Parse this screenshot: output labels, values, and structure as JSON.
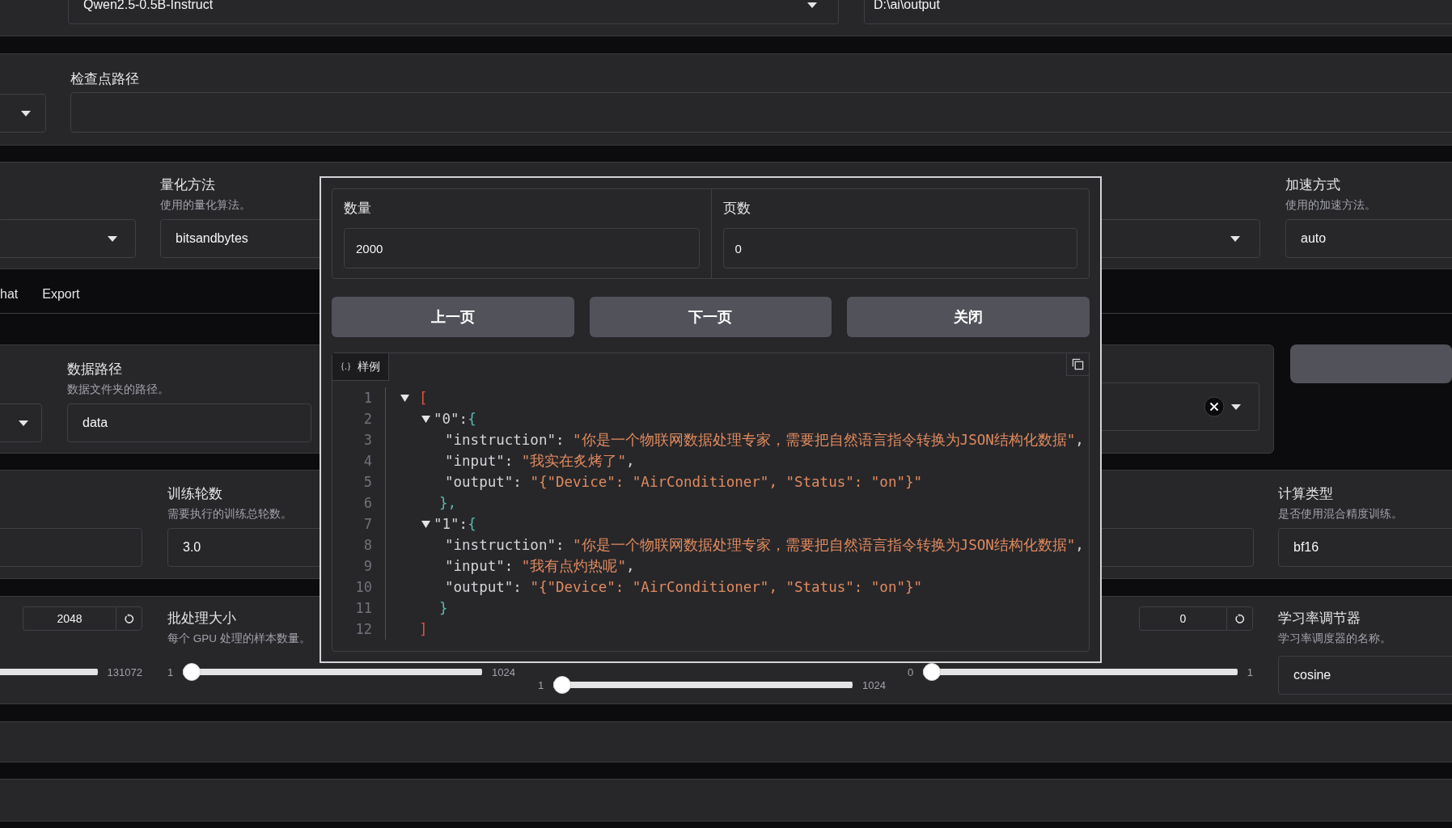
{
  "top_row": {
    "model_name": "Qwen2.5-0.5B-Instruct",
    "output_dir": "D:\\ai\\output"
  },
  "checkpoint": {
    "label": "检查点路径"
  },
  "quantization": {
    "label": "量化方法",
    "description": "使用的量化算法。",
    "value": "bitsandbytes"
  },
  "acceleration": {
    "label": "加速方式",
    "description": "使用的加速方法。",
    "value": "auto"
  },
  "tabs": [
    {
      "label": "hat",
      "selected": false
    },
    {
      "label": "Export",
      "selected": false
    }
  ],
  "dataset_dir": {
    "label": "数据路径",
    "description": "数据文件夹的路径。",
    "value": "data"
  },
  "epochs": {
    "label": "训练轮数",
    "description": "需要执行的训练总轮数。",
    "value": "3.0"
  },
  "compute_type": {
    "label": "计算类型",
    "description": "是否使用混合精度训练。",
    "value": "bf16"
  },
  "cutoff": {
    "value": "2048",
    "max": "131072"
  },
  "batch_size": {
    "label": "批处理大小",
    "description": "每个 GPU 处理的样本数量。",
    "min": "1",
    "max": "1024",
    "level": 0
  },
  "column_3": {
    "min": "1",
    "max": "1024",
    "level": 0
  },
  "column_4": {
    "value": "0",
    "min": "0",
    "max": "1",
    "level": 0
  },
  "lr_scheduler": {
    "label": "学习率调节器",
    "description": "学习率调度器的名称。",
    "value": "cosine"
  },
  "modal": {
    "count": {
      "label": "数量",
      "value": "2000"
    },
    "page": {
      "label": "页数",
      "value": "0"
    },
    "buttons": [
      "上一页",
      "下一页",
      "关闭"
    ],
    "preview": {
      "tab": "样例",
      "line_numbers": [
        "1",
        "2",
        "3",
        "4",
        "5",
        "6",
        "7",
        "8",
        "9",
        "10",
        "11",
        "12"
      ],
      "root": {
        "open": "[",
        "close": "]",
        "expanded": true,
        "items": [
          {
            "key": "\"0\":",
            "open": "{",
            "close": "},",
            "expanded": true,
            "fields": [
              {
                "key": "\"instruction\":",
                "value": "\"你是一个物联网数据处理专家，需要把自然语言指令转换为JSON结构化数据\"",
                "sep": ","
              },
              {
                "key": "\"input\":",
                "value": "\"我实在炙烤了\"",
                "sep": ","
              },
              {
                "key": "\"output\":",
                "value": "\"{\"Device\": \"AirConditioner\", \"Status\": \"on\"}\""
              }
            ]
          },
          {
            "key": "\"1\":",
            "open": "{",
            "close": "}",
            "expanded": true,
            "fields": [
              {
                "key": "\"instruction\":",
                "value": "\"你是一个物联网数据处理专家，需要把自然语言指令转换为JSON结构化数据\"",
                "sep": ","
              },
              {
                "key": "\"input\":",
                "value": "\"我有点灼热呢\"",
                "sep": ","
              },
              {
                "key": "\"output\":",
                "value": "\"{\"Device\": \"AirConditioner\", \"Status\": \"on\"}\""
              }
            ]
          }
        ]
      }
    }
  }
}
